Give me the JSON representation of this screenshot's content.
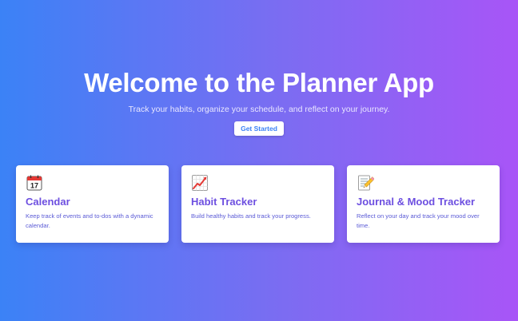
{
  "hero": {
    "title": "Welcome to the Planner App",
    "subtitle": "Track your habits, organize your schedule, and reflect on your journey.",
    "cta_label": "Get Started"
  },
  "features": [
    {
      "icon": "calendar-icon",
      "icon_badge": "17",
      "title": "Calendar",
      "description": "Keep track of events and to-dos with a dynamic calendar."
    },
    {
      "icon": "chart-increasing-icon",
      "title": "Habit Tracker",
      "description": "Build healthy habits and track your progress."
    },
    {
      "icon": "memo-pencil-icon",
      "title": "Journal & Mood Tracker",
      "description": "Reflect on your day and track your mood over time."
    }
  ],
  "colors": {
    "gradient_start": "#3b82f6",
    "gradient_end": "#a855f7",
    "card_title": "#6d4fe0",
    "card_text": "#5b5bd6",
    "button_text": "#3b82f6"
  }
}
